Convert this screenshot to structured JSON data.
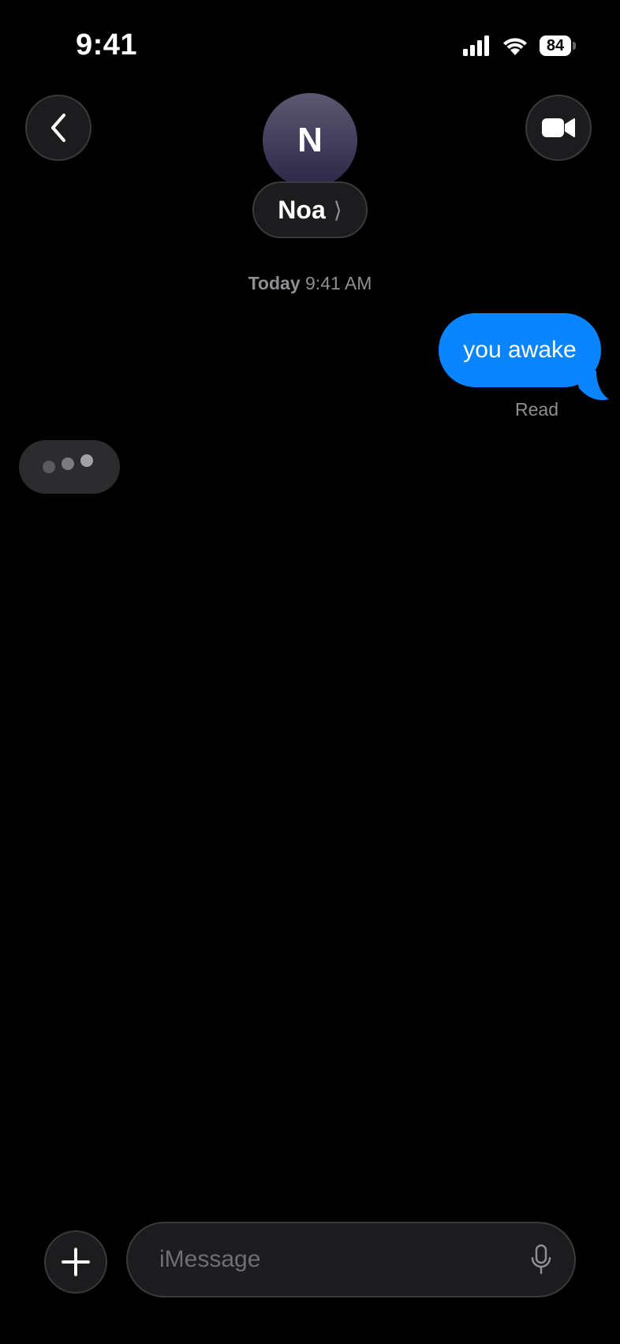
{
  "status_bar": {
    "time": "9:41",
    "battery_level": "84",
    "icons": [
      "signal-icon",
      "wifi-icon",
      "battery-icon"
    ]
  },
  "header": {
    "avatar_initial": "N",
    "contact_name": "Noa",
    "name_chevron": "⟩",
    "back_icon": "chevron-left-icon",
    "video_icon": "video-camera-icon"
  },
  "conversation": {
    "timestamp_day": "Today",
    "timestamp_time": "9:41 AM",
    "messages": [
      {
        "direction": "sent",
        "text": "you awake"
      }
    ],
    "read_receipt": "Read",
    "typing_indicator": true
  },
  "composer": {
    "placeholder": "iMessage",
    "value": "",
    "plus_icon": "plus-icon",
    "mic_icon": "microphone-icon"
  },
  "colors": {
    "background": "#000000",
    "sent_bubble": "#0a84ff",
    "received_bubble": "#2c2c2e",
    "secondary_text": "#8e8e93",
    "control_fill": "#1c1c1e"
  }
}
